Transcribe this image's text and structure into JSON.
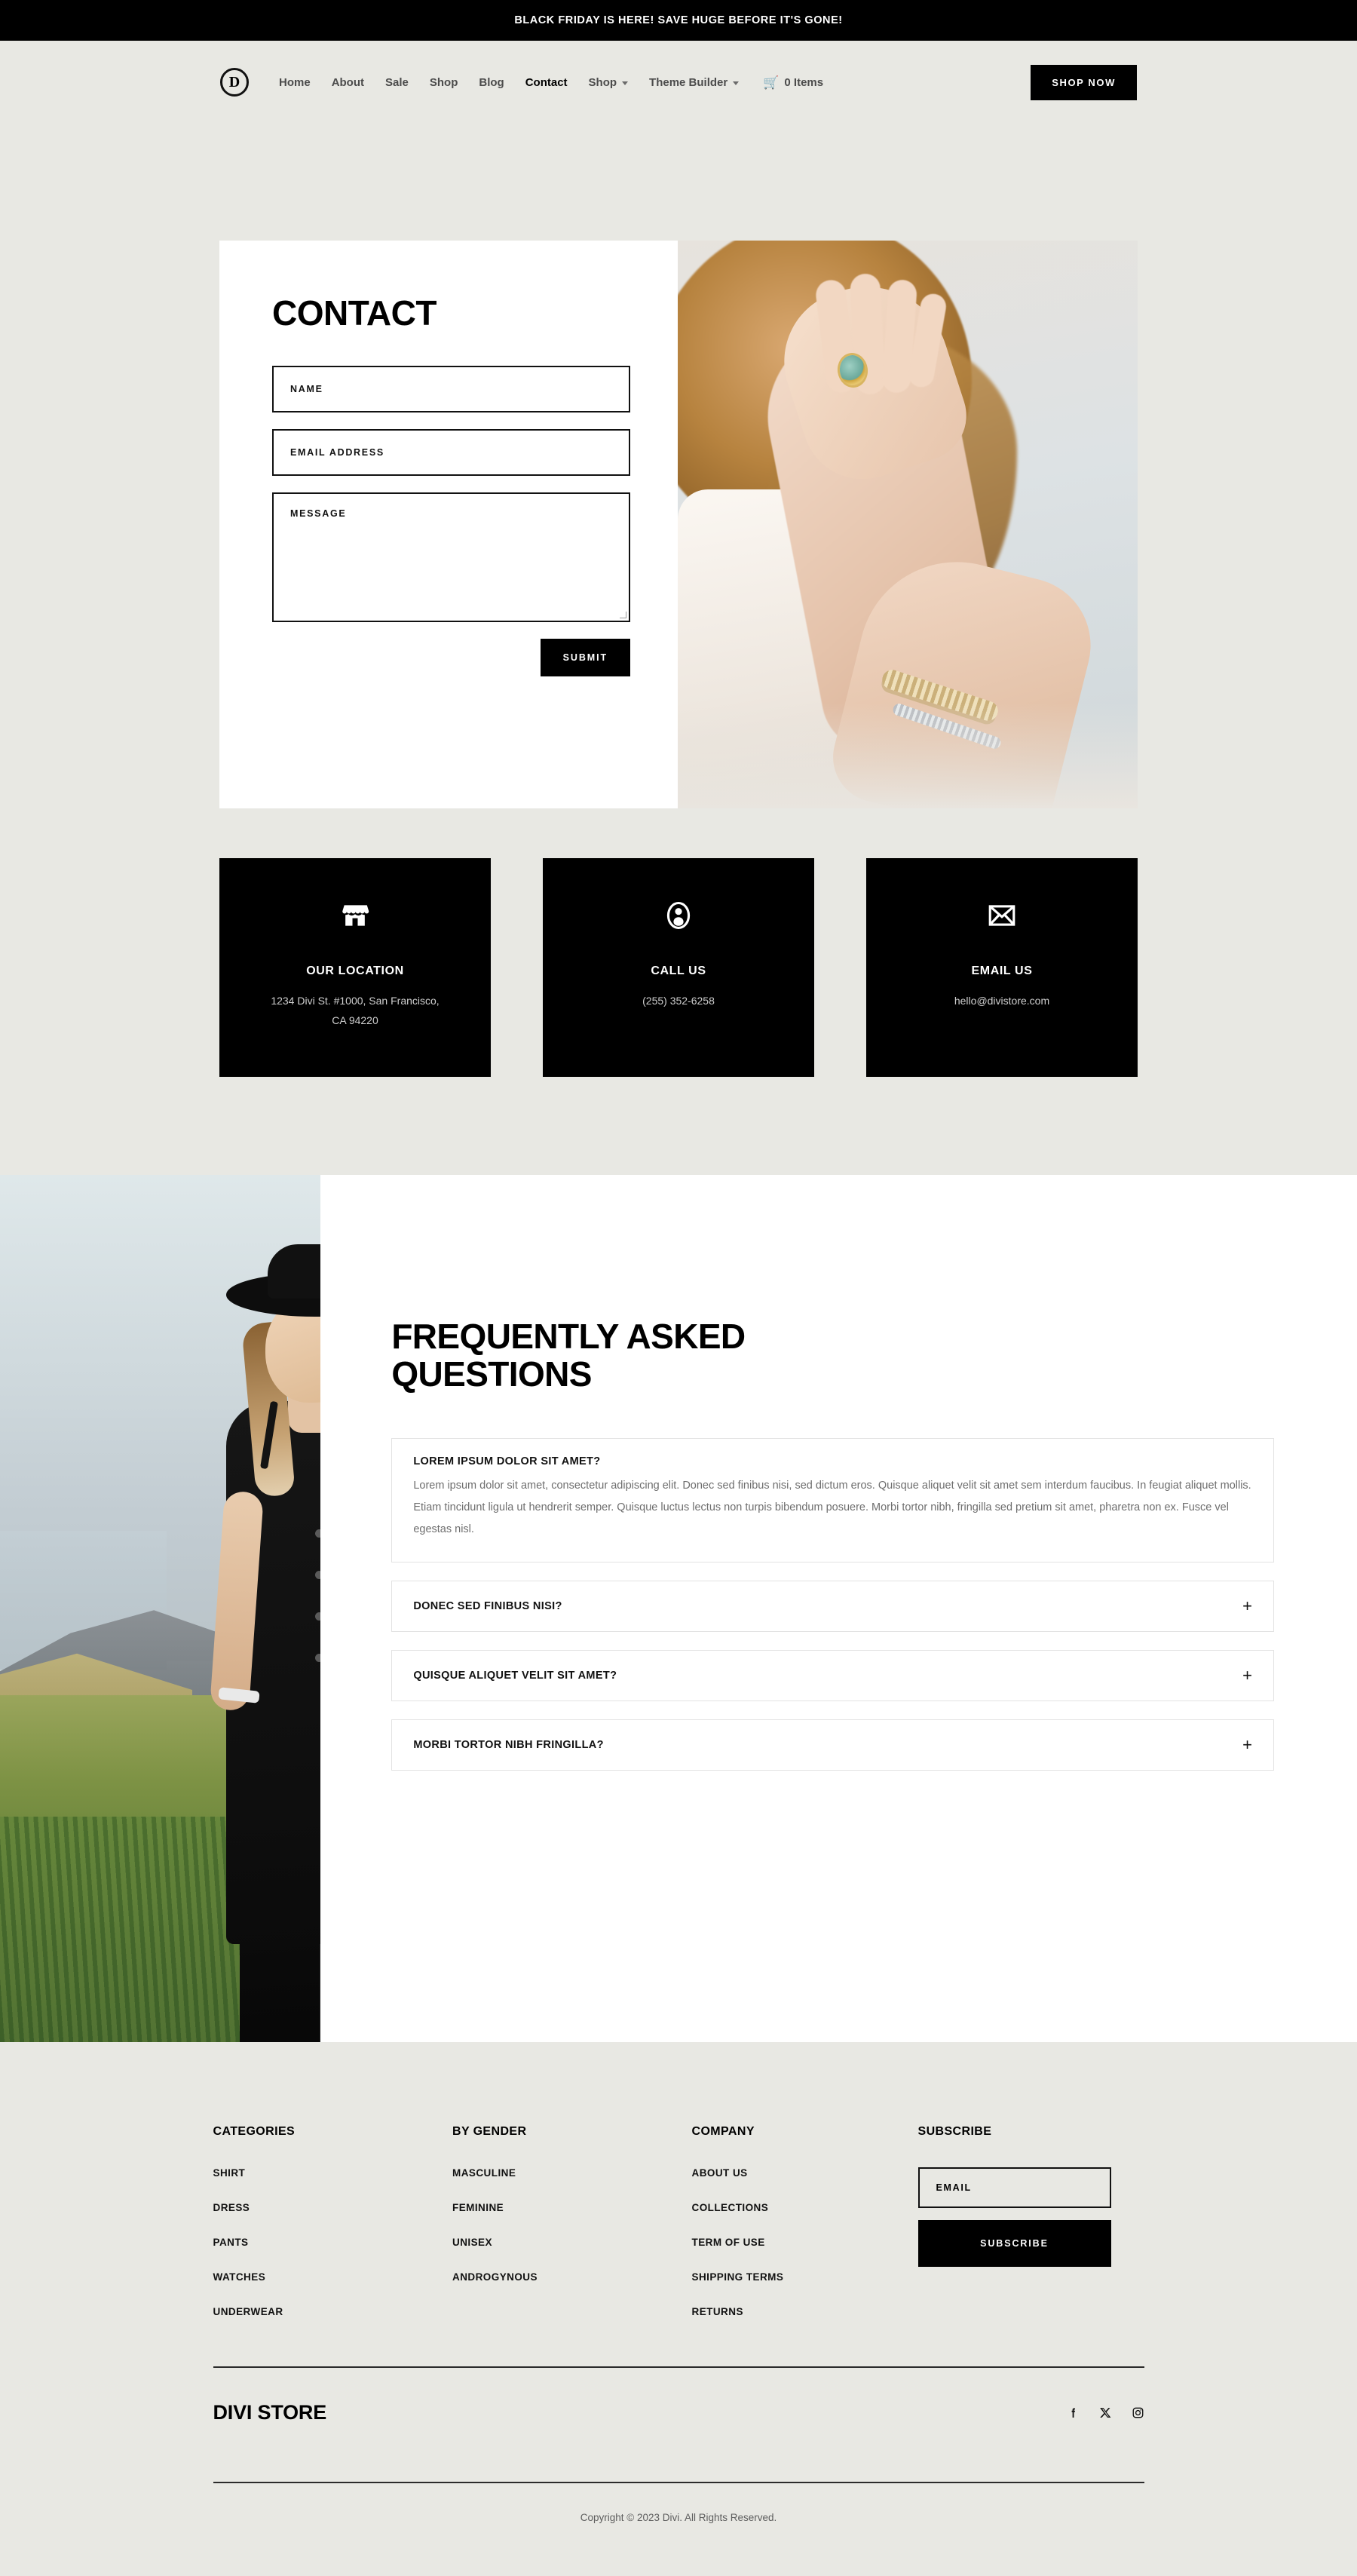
{
  "announcement": {
    "text": "BLACK FRIDAY IS HERE! SAVE HUGE BEFORE IT'S GONE!"
  },
  "header": {
    "logo_letter": "D",
    "nav": [
      {
        "label": "Home",
        "active": false,
        "has_caret": false
      },
      {
        "label": "About",
        "active": false,
        "has_caret": false
      },
      {
        "label": "Sale",
        "active": false,
        "has_caret": false
      },
      {
        "label": "Shop",
        "active": false,
        "has_caret": false
      },
      {
        "label": "Blog",
        "active": false,
        "has_caret": false
      },
      {
        "label": "Contact",
        "active": true,
        "has_caret": false
      },
      {
        "label": "Shop",
        "active": false,
        "has_caret": true
      },
      {
        "label": "Theme Builder",
        "active": false,
        "has_caret": true
      }
    ],
    "cart_label": "0 Items",
    "shop_now_label": "SHOP NOW"
  },
  "contact": {
    "title": "CONTACT",
    "fields": {
      "name_placeholder": "NAME",
      "email_placeholder": "EMAIL ADDRESS",
      "message_placeholder": "MESSAGE"
    },
    "submit_label": "SUBMIT"
  },
  "info_cards": [
    {
      "icon": "storefront-icon",
      "title": "OUR LOCATION",
      "text": "1234 Divi St. #1000, San Francisco, CA 94220"
    },
    {
      "icon": "user-circle-icon",
      "title": "CALL US",
      "text": "(255) 352-6258"
    },
    {
      "icon": "envelope-icon",
      "title": "EMAIL US",
      "text": "hello@divistore.com"
    }
  ],
  "faq": {
    "heading": "FREQUENTLY ASKED QUESTIONS",
    "items": [
      {
        "question": "LOREM IPSUM DOLOR SIT AMET?",
        "open": true,
        "toggle": "",
        "answer": "Lorem ipsum dolor sit amet, consectetur adipiscing elit. Donec sed finibus nisi, sed dictum eros. Quisque aliquet velit sit amet sem interdum faucibus. In feugiat aliquet mollis. Etiam tincidunt ligula ut hendrerit semper. Quisque luctus lectus non turpis bibendum posuere. Morbi tortor nibh, fringilla sed pretium sit amet, pharetra non ex. Fusce vel egestas nisl."
      },
      {
        "question": "DONEC SED FINIBUS NISI?",
        "open": false,
        "toggle": "+",
        "answer": ""
      },
      {
        "question": "QUISQUE ALIQUET VELIT SIT AMET?",
        "open": false,
        "toggle": "+",
        "answer": ""
      },
      {
        "question": "MORBI TORTOR NIBH FRINGILLA?",
        "open": false,
        "toggle": "+",
        "answer": ""
      }
    ]
  },
  "footer": {
    "columns": [
      {
        "title": "CATEGORIES",
        "links": [
          "SHIRT",
          "DRESS",
          "PANTS",
          "WATCHES",
          "UNDERWEAR"
        ]
      },
      {
        "title": "BY GENDER",
        "links": [
          "MASCULINE",
          "FEMININE",
          "UNISEX",
          "ANDROGYNOUS"
        ]
      },
      {
        "title": "COMPANY",
        "links": [
          "ABOUT US",
          "COLLECTIONS",
          "TERM OF USE",
          "SHIPPING TERMS",
          "RETURNS"
        ]
      }
    ],
    "subscribe": {
      "title": "SUBSCRIBE",
      "email_placeholder": "EMAIL",
      "button_label": "SUBSCRIBE"
    },
    "brand_name": "DIVI STORE",
    "socials": [
      "facebook-icon",
      "x-twitter-icon",
      "instagram-icon"
    ],
    "copyright": "Copyright © 2023 Divi. All Rights Reserved."
  },
  "colors": {
    "page_background": "#e8e8e3",
    "accent_black": "#000000",
    "card_white": "#ffffff",
    "muted_text": "#6e6e6e"
  }
}
